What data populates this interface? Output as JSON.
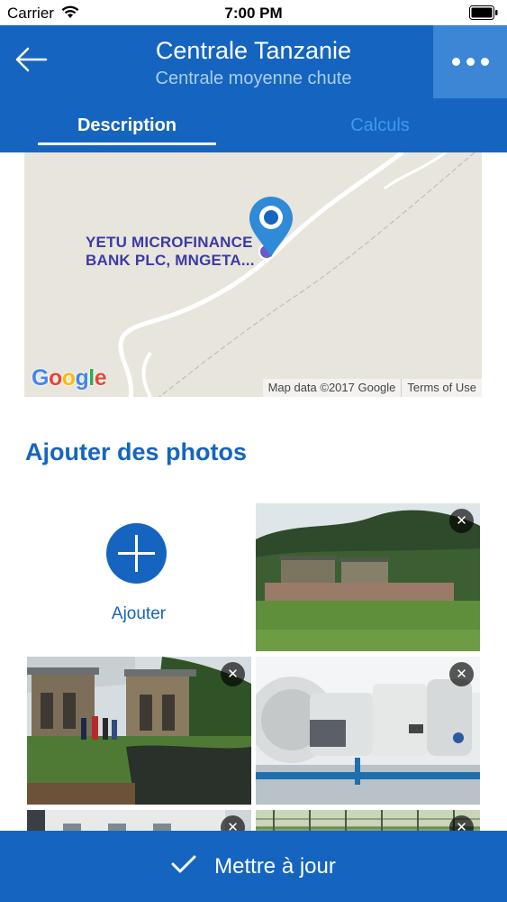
{
  "status_bar": {
    "carrier": "Carrier",
    "time": "7:00 PM"
  },
  "header": {
    "title": "Centrale Tanzanie",
    "subtitle": "Centrale moyenne chute",
    "tabs": [
      {
        "label": "Description",
        "active": true
      },
      {
        "label": "Calculs",
        "active": false
      }
    ],
    "colors": {
      "primary": "#1565c0",
      "more_button_bg": "#3d86d6",
      "inactive_tab": "#3b9be9"
    }
  },
  "map": {
    "poi_label_line1": "YETU MICROFINANCE",
    "poi_label_line2": "BANK PLC, MNGETA...",
    "attribution": "Map data ©2017 Google",
    "terms": "Terms of Use",
    "logo_letters": [
      "G",
      "o",
      "o",
      "g",
      "l",
      "e"
    ]
  },
  "photos_section": {
    "title": "Ajouter des photos",
    "add_label": "Ajouter",
    "photos": [
      {
        "subject": "power plant building on hillside",
        "removable": true
      },
      {
        "subject": "intake structure with people",
        "removable": true
      },
      {
        "subject": "turbine generators",
        "removable": true
      },
      {
        "subject": "building facade",
        "removable": true
      },
      {
        "subject": "fenced area",
        "removable": true
      }
    ]
  },
  "footer": {
    "button_label": "Mettre à jour"
  }
}
